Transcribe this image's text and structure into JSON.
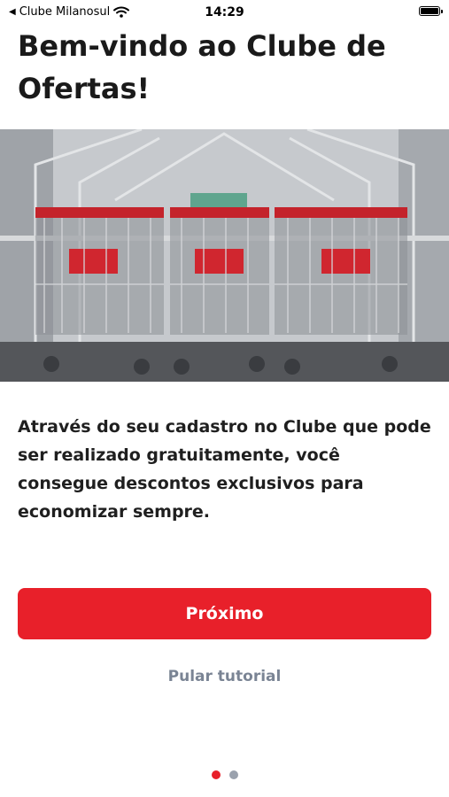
{
  "status_bar": {
    "back_label": "Clube Milanosul",
    "time": "14:29",
    "icons": [
      "back-arrow-icon",
      "wifi-icon",
      "battery-icon"
    ]
  },
  "onboarding": {
    "title": "Bem-vindo ao Clube de Ofertas!",
    "image": "shopping-carts-photo",
    "description": "Através do seu cadastro no Clube que pode ser realizado gratuitamente, você consegue descontos exclusivos para economizar sempre.",
    "next_label": "Próximo",
    "skip_label": "Pular tutorial",
    "page_count": 2,
    "current_page": 1
  },
  "colors": {
    "accent": "#e8202a",
    "muted_text": "#7a8494",
    "dot_active": "#e8202a",
    "dot_inactive": "#9aa1ad"
  }
}
